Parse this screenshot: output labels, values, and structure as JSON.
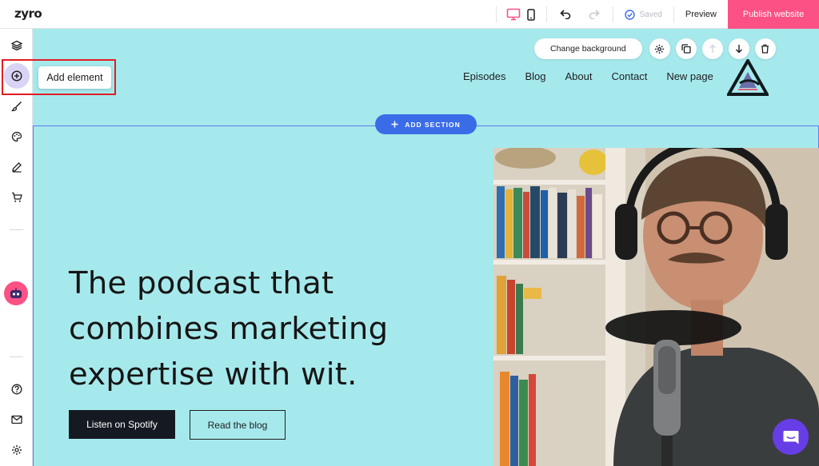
{
  "app": {
    "logo": "zyro"
  },
  "topbar": {
    "saved_label": "Saved",
    "preview_label": "Preview",
    "publish_label": "Publish website"
  },
  "sidebar": {
    "tooltip": "Add element"
  },
  "canvas": {
    "nav": [
      "Episodes",
      "Blog",
      "About",
      "Contact",
      "New page"
    ],
    "toolbar": {
      "change_background": "Change background"
    },
    "add_section": "ADD SECTION",
    "headline": "The podcast that combines marketing expertise with wit.",
    "cta_primary": "Listen on Spotify",
    "cta_secondary": "Read the blog"
  },
  "colors": {
    "canvas_bg": "#a6e9ec",
    "publish": "#fc5185",
    "accent_blue": "#3b6ce8",
    "chat": "#673de6",
    "highlight": "#e11d24"
  }
}
